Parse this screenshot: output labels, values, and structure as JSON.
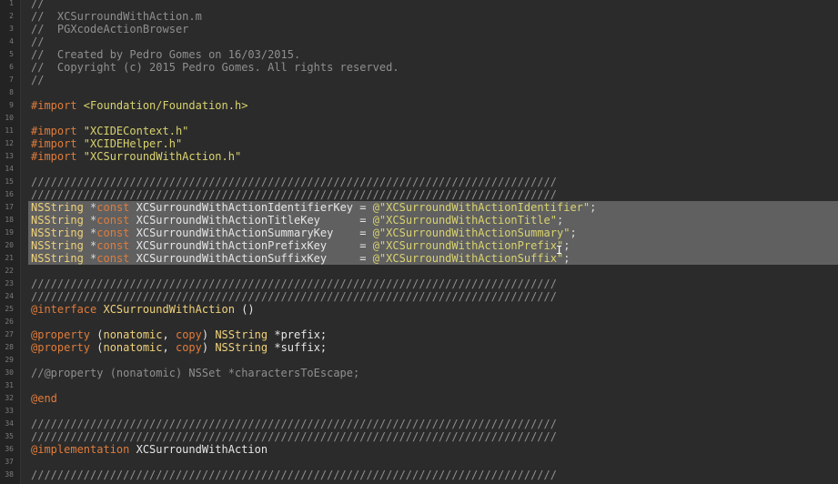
{
  "editor": {
    "lines": [
      {
        "n": "1",
        "sel": false,
        "tokens": [
          {
            "t": "//",
            "c": "comment"
          }
        ]
      },
      {
        "n": "2",
        "sel": false,
        "tokens": [
          {
            "t": "//  XCSurroundWithAction.m",
            "c": "comment"
          }
        ]
      },
      {
        "n": "3",
        "sel": false,
        "tokens": [
          {
            "t": "//  PGXcodeActionBrowser",
            "c": "comment"
          }
        ]
      },
      {
        "n": "4",
        "sel": false,
        "tokens": [
          {
            "t": "//",
            "c": "comment"
          }
        ]
      },
      {
        "n": "5",
        "sel": false,
        "tokens": [
          {
            "t": "//  Created by Pedro Gomes on 16/03/2015.",
            "c": "comment"
          }
        ]
      },
      {
        "n": "6",
        "sel": false,
        "tokens": [
          {
            "t": "//  Copyright (c) 2015 Pedro Gomes. All rights reserved.",
            "c": "comment"
          }
        ]
      },
      {
        "n": "7",
        "sel": false,
        "tokens": [
          {
            "t": "//",
            "c": "comment"
          }
        ]
      },
      {
        "n": "8",
        "sel": false,
        "tokens": []
      },
      {
        "n": "9",
        "sel": false,
        "tokens": [
          {
            "t": "#import ",
            "c": "pre"
          },
          {
            "t": "<Foundation/Foundation.h>",
            "c": "inc"
          }
        ]
      },
      {
        "n": "10",
        "sel": false,
        "tokens": []
      },
      {
        "n": "11",
        "sel": false,
        "tokens": [
          {
            "t": "#import ",
            "c": "pre"
          },
          {
            "t": "\"XCIDEContext.h\"",
            "c": "inc"
          }
        ]
      },
      {
        "n": "12",
        "sel": false,
        "tokens": [
          {
            "t": "#import ",
            "c": "pre"
          },
          {
            "t": "\"XCIDEHelper.h\"",
            "c": "inc"
          }
        ]
      },
      {
        "n": "13",
        "sel": false,
        "tokens": [
          {
            "t": "#import ",
            "c": "pre"
          },
          {
            "t": "\"XCSurroundWithAction.h\"",
            "c": "inc"
          }
        ]
      },
      {
        "n": "14",
        "sel": false,
        "tokens": []
      },
      {
        "n": "15",
        "sel": false,
        "tokens": [
          {
            "t": "////////////////////////////////////////////////////////////////////////////////",
            "c": "comment"
          }
        ]
      },
      {
        "n": "16",
        "sel": false,
        "tokens": [
          {
            "t": "////////////////////////////////////////////////////////////////////////////////",
            "c": "comment"
          }
        ]
      },
      {
        "n": "17",
        "sel": true,
        "tokens": [
          {
            "t": "NSString ",
            "c": "type"
          },
          {
            "t": "*",
            "c": "punc"
          },
          {
            "t": "const",
            "c": "kw"
          },
          {
            "t": " XCSurroundWithActionIdentifierKey = ",
            "c": "plain"
          },
          {
            "t": "@\"XCSurroundWithActionIdentifier\"",
            "c": "str"
          },
          {
            "t": ";",
            "c": "punc"
          }
        ]
      },
      {
        "n": "18",
        "sel": true,
        "tokens": [
          {
            "t": "NSString ",
            "c": "type"
          },
          {
            "t": "*",
            "c": "punc"
          },
          {
            "t": "const",
            "c": "kw"
          },
          {
            "t": " XCSurroundWithActionTitleKey      = ",
            "c": "plain"
          },
          {
            "t": "@\"XCSurroundWithActionTitle\"",
            "c": "str"
          },
          {
            "t": ";",
            "c": "punc"
          }
        ]
      },
      {
        "n": "19",
        "sel": true,
        "tokens": [
          {
            "t": "NSString ",
            "c": "type"
          },
          {
            "t": "*",
            "c": "punc"
          },
          {
            "t": "const",
            "c": "kw"
          },
          {
            "t": " XCSurroundWithActionSummaryKey    = ",
            "c": "plain"
          },
          {
            "t": "@\"XCSurroundWithActionSummary\"",
            "c": "str"
          },
          {
            "t": ";",
            "c": "punc"
          }
        ]
      },
      {
        "n": "20",
        "sel": true,
        "tokens": [
          {
            "t": "NSString ",
            "c": "type"
          },
          {
            "t": "*",
            "c": "punc"
          },
          {
            "t": "const",
            "c": "kw"
          },
          {
            "t": " XCSurroundWithActionPrefixKey     = ",
            "c": "plain"
          },
          {
            "t": "@\"XCSurroundWithActionPrefix\"",
            "c": "str"
          },
          {
            "t": ";",
            "c": "punc"
          }
        ]
      },
      {
        "n": "21",
        "sel": true,
        "tokens": [
          {
            "t": "NSString ",
            "c": "type"
          },
          {
            "t": "*",
            "c": "punc"
          },
          {
            "t": "const",
            "c": "kw"
          },
          {
            "t": " XCSurroundWithActionSuffixKey     = ",
            "c": "plain"
          },
          {
            "t": "@\"XCSurroundWithActionSuffix\"",
            "c": "str"
          },
          {
            "t": ";",
            "c": "punc"
          }
        ]
      },
      {
        "n": "22",
        "sel": false,
        "tokens": []
      },
      {
        "n": "23",
        "sel": false,
        "tokens": [
          {
            "t": "////////////////////////////////////////////////////////////////////////////////",
            "c": "comment"
          }
        ]
      },
      {
        "n": "24",
        "sel": false,
        "tokens": [
          {
            "t": "////////////////////////////////////////////////////////////////////////////////",
            "c": "comment"
          }
        ]
      },
      {
        "n": "25",
        "sel": false,
        "tokens": [
          {
            "t": "@interface",
            "c": "kw"
          },
          {
            "t": " ",
            "c": "plain"
          },
          {
            "t": "XCSurroundWithAction",
            "c": "type"
          },
          {
            "t": " ()",
            "c": "plain"
          }
        ]
      },
      {
        "n": "26",
        "sel": false,
        "tokens": []
      },
      {
        "n": "27",
        "sel": false,
        "tokens": [
          {
            "t": "@property",
            "c": "kw"
          },
          {
            "t": " (",
            "c": "plain"
          },
          {
            "t": "nonatomic",
            "c": "type"
          },
          {
            "t": ", ",
            "c": "plain"
          },
          {
            "t": "copy",
            "c": "kw"
          },
          {
            "t": ") ",
            "c": "plain"
          },
          {
            "t": "NSString",
            "c": "type"
          },
          {
            "t": " *prefix;",
            "c": "plain"
          }
        ]
      },
      {
        "n": "28",
        "sel": false,
        "tokens": [
          {
            "t": "@property",
            "c": "kw"
          },
          {
            "t": " (",
            "c": "plain"
          },
          {
            "t": "nonatomic",
            "c": "type"
          },
          {
            "t": ", ",
            "c": "plain"
          },
          {
            "t": "copy",
            "c": "kw"
          },
          {
            "t": ") ",
            "c": "plain"
          },
          {
            "t": "NSString",
            "c": "type"
          },
          {
            "t": " *suffix;",
            "c": "plain"
          }
        ]
      },
      {
        "n": "29",
        "sel": false,
        "tokens": []
      },
      {
        "n": "30",
        "sel": false,
        "tokens": [
          {
            "t": "//@property (nonatomic) NSSet *charactersToEscape;",
            "c": "comment"
          }
        ]
      },
      {
        "n": "31",
        "sel": false,
        "tokens": []
      },
      {
        "n": "32",
        "sel": false,
        "tokens": [
          {
            "t": "@end",
            "c": "kw"
          }
        ]
      },
      {
        "n": "33",
        "sel": false,
        "tokens": []
      },
      {
        "n": "34",
        "sel": false,
        "tokens": [
          {
            "t": "////////////////////////////////////////////////////////////////////////////////",
            "c": "comment"
          }
        ]
      },
      {
        "n": "35",
        "sel": false,
        "tokens": [
          {
            "t": "////////////////////////////////////////////////////////////////////////////////",
            "c": "comment"
          }
        ]
      },
      {
        "n": "36",
        "sel": false,
        "tokens": [
          {
            "t": "@implementation",
            "c": "kw"
          },
          {
            "t": " XCSurroundWithAction",
            "c": "plain"
          }
        ]
      },
      {
        "n": "37",
        "sel": false,
        "tokens": []
      },
      {
        "n": "38",
        "sel": false,
        "tokens": [
          {
            "t": "////////////////////////////////////////////////////////////////////////////////",
            "c": "comment"
          }
        ]
      }
    ]
  },
  "colors": {
    "background": "#2b2b2b",
    "selection": "#606060",
    "comment": "#8f8f8f",
    "keyword": "#e07c3b",
    "string": "#d9d36e",
    "type": "#f0d27a"
  },
  "cursor": {
    "icon": "ibeam-cursor-icon",
    "glyph": "I"
  }
}
